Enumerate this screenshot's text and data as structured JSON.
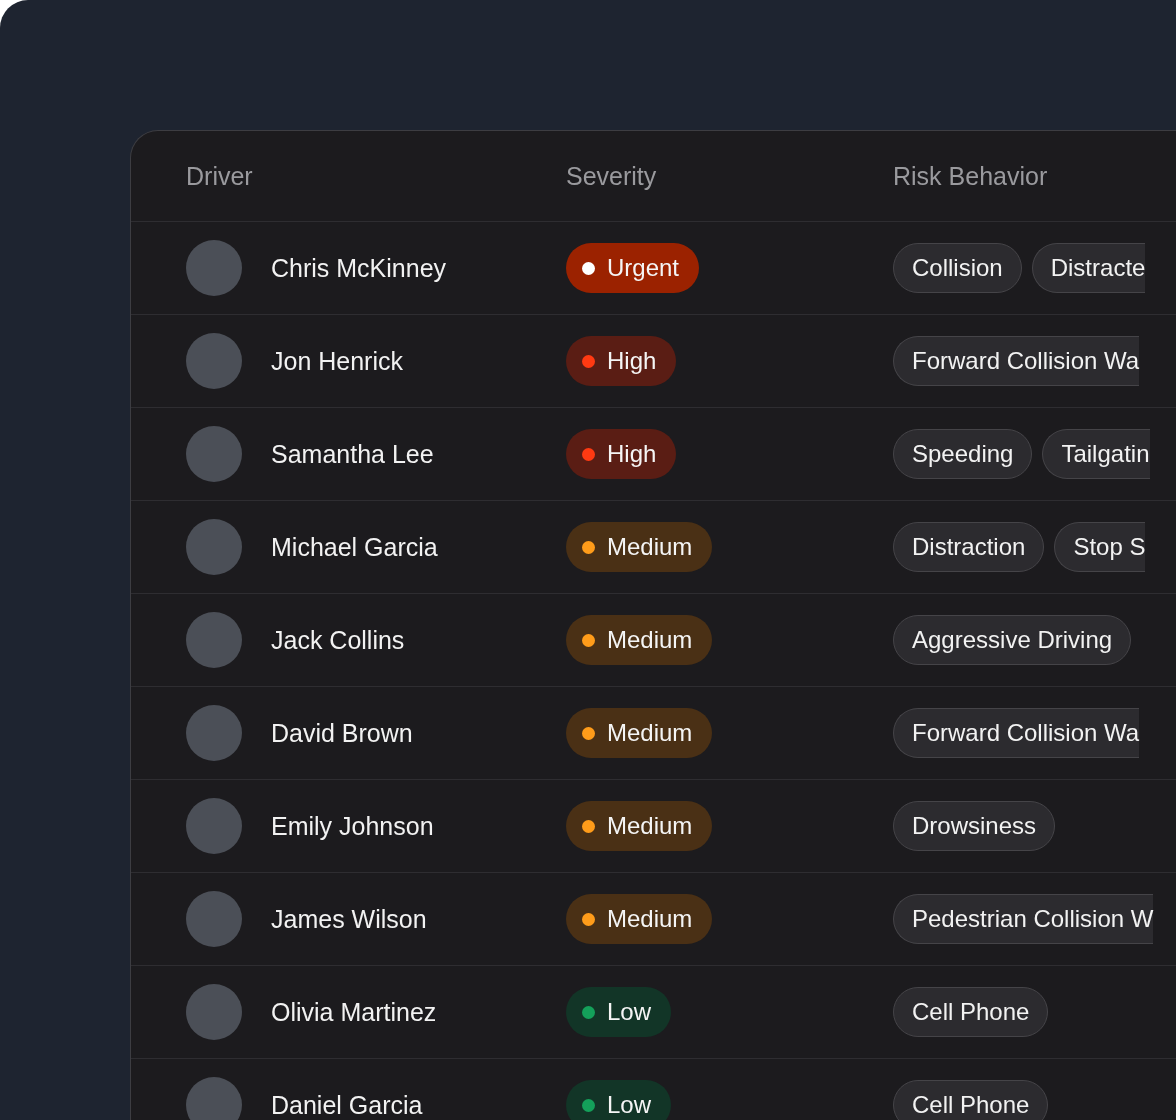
{
  "table": {
    "columns": [
      "Driver",
      "Severity",
      "Risk Behavior"
    ],
    "rows": [
      {
        "driver": "Chris McKinney",
        "severity": {
          "label": "Urgent",
          "kind": "urgent"
        },
        "behaviors": [
          {
            "label": "Collision",
            "cut": false
          },
          {
            "label": "Distracte",
            "cut": true
          }
        ]
      },
      {
        "driver": "Jon Henrick",
        "severity": {
          "label": "High",
          "kind": "high"
        },
        "behaviors": [
          {
            "label": "Forward Collision Wa",
            "cut": true
          }
        ]
      },
      {
        "driver": "Samantha Lee",
        "severity": {
          "label": "High",
          "kind": "high"
        },
        "behaviors": [
          {
            "label": "Speeding",
            "cut": false
          },
          {
            "label": "Tailgatin",
            "cut": true
          }
        ]
      },
      {
        "driver": "Michael Garcia",
        "severity": {
          "label": "Medium",
          "kind": "medium"
        },
        "behaviors": [
          {
            "label": "Distraction",
            "cut": false
          },
          {
            "label": "Stop S",
            "cut": true
          }
        ]
      },
      {
        "driver": "Jack Collins",
        "severity": {
          "label": "Medium",
          "kind": "medium"
        },
        "behaviors": [
          {
            "label": "Aggressive Driving",
            "cut": false
          }
        ]
      },
      {
        "driver": "David Brown",
        "severity": {
          "label": "Medium",
          "kind": "medium"
        },
        "behaviors": [
          {
            "label": "Forward Collision Wa",
            "cut": true
          }
        ]
      },
      {
        "driver": "Emily Johnson",
        "severity": {
          "label": "Medium",
          "kind": "medium"
        },
        "behaviors": [
          {
            "label": "Drowsiness",
            "cut": false
          }
        ]
      },
      {
        "driver": "James Wilson",
        "severity": {
          "label": "Medium",
          "kind": "medium"
        },
        "behaviors": [
          {
            "label": "Pedestrian Collision W",
            "cut": true
          }
        ]
      },
      {
        "driver": "Olivia Martinez",
        "severity": {
          "label": "Low",
          "kind": "low"
        },
        "behaviors": [
          {
            "label": "Cell Phone",
            "cut": false
          }
        ]
      },
      {
        "driver": "Daniel Garcia",
        "severity": {
          "label": "Low",
          "kind": "low"
        },
        "behaviors": [
          {
            "label": "Cell Phone",
            "cut": false
          }
        ]
      }
    ]
  }
}
